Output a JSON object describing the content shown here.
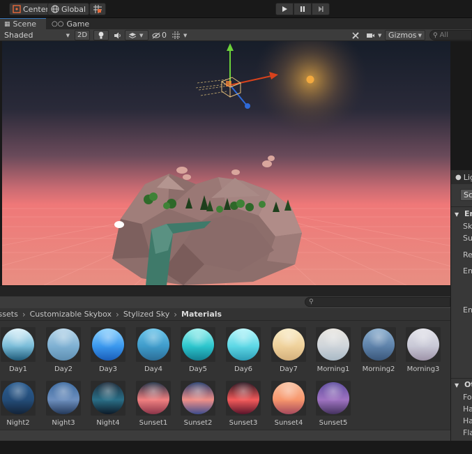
{
  "toolbar": {
    "pivot_label": "Center",
    "space_label": "Global",
    "play_icon": "play-icon",
    "pause_icon": "pause-icon",
    "step_icon": "step-icon"
  },
  "tabs": [
    {
      "label": "Scene",
      "icon": "grid-icon"
    },
    {
      "label": "Game",
      "icon": "gamepad-icon"
    }
  ],
  "scene_bar": {
    "draw_mode": "Shaded",
    "mode_2d": "2D",
    "hidden_count": "0",
    "gizmos_label": "Gizmos",
    "search_placeholder": "All"
  },
  "lighting_panel": {
    "tab_title": "Lighting",
    "scene_tab": "Scene",
    "section_environment": "Environment",
    "section_other": "Other Settings",
    "lines_env": [
      "Skybox Material",
      "Sun Source",
      "Realtime Shadow Color",
      "Environment Lighting"
    ],
    "lines_reflect": [
      "Environment Reflections"
    ],
    "lines_other": [
      "Fog",
      "Halo Texture",
      "Halo Strength",
      "Flare Fade Speed"
    ]
  },
  "breadcrumbs": [
    "Assets",
    "Customizable Skybox",
    "Stylized Sky",
    "Materials"
  ],
  "materials_row1": [
    {
      "name": "Day1",
      "top": "#dff3fb",
      "mid": "#79bcd8",
      "bot": "#1f5a78"
    },
    {
      "name": "Day2",
      "top": "#b7d6ea",
      "mid": "#7fb1d3",
      "bot": "#5f8fb2"
    },
    {
      "name": "Day3",
      "top": "#8fd3ff",
      "mid": "#3a98ee",
      "bot": "#1a5db8"
    },
    {
      "name": "Day4",
      "top": "#6cc5ea",
      "mid": "#3f9ccb",
      "bot": "#2c6d96"
    },
    {
      "name": "Day5",
      "top": "#9ff1ef",
      "mid": "#2cc6cd",
      "bot": "#137e90"
    },
    {
      "name": "Day6",
      "top": "#b8f6fb",
      "mid": "#5dd8e6",
      "bot": "#2d9db6"
    },
    {
      "name": "Day7",
      "top": "#f9ecc7",
      "mid": "#efd19b",
      "bot": "#d4b07c"
    },
    {
      "name": "Morning1",
      "top": "#e9e6e0",
      "mid": "#cfd5da",
      "bot": "#a9b9c6"
    },
    {
      "name": "Morning2",
      "top": "#8cafcf",
      "mid": "#5e82aa",
      "bot": "#3a577a"
    },
    {
      "name": "Morning3",
      "top": "#e3e3ea",
      "mid": "#c8c8d6",
      "bot": "#9e93a8"
    }
  ],
  "materials_row2": [
    {
      "name": "Night2",
      "top": "#2b5d90",
      "mid": "#244c78",
      "bot": "#132338"
    },
    {
      "name": "Night3",
      "top": "#3c6aa0",
      "mid": "#6d8fbe",
      "bot": "#24395a"
    },
    {
      "name": "Night4",
      "top": "#1e2d3d",
      "mid": "#2a6e86",
      "bot": "#0d1a28"
    },
    {
      "name": "Sunset1",
      "top": "#1f2f44",
      "mid": "#f08080",
      "bot": "#8a3448"
    },
    {
      "name": "Sunset2",
      "top": "#243b6b",
      "mid": "#ef8f88",
      "bot": "#3d4c8d"
    },
    {
      "name": "Sunset3",
      "top": "#2b1722",
      "mid": "#f25a5a",
      "bot": "#58142a"
    },
    {
      "name": "Sunset4",
      "top": "#f7c0a0",
      "mid": "#f7966c",
      "bot": "#a4485c"
    },
    {
      "name": "Sunset5",
      "top": "#5e4d9f",
      "mid": "#9f73c1",
      "bot": "#44325f"
    }
  ],
  "colors": {
    "accent": "#3a79bb",
    "sky_top": "#161d29",
    "horizon": "#ef7878",
    "ground": "#e88e82",
    "sun": "#f3a93f"
  }
}
